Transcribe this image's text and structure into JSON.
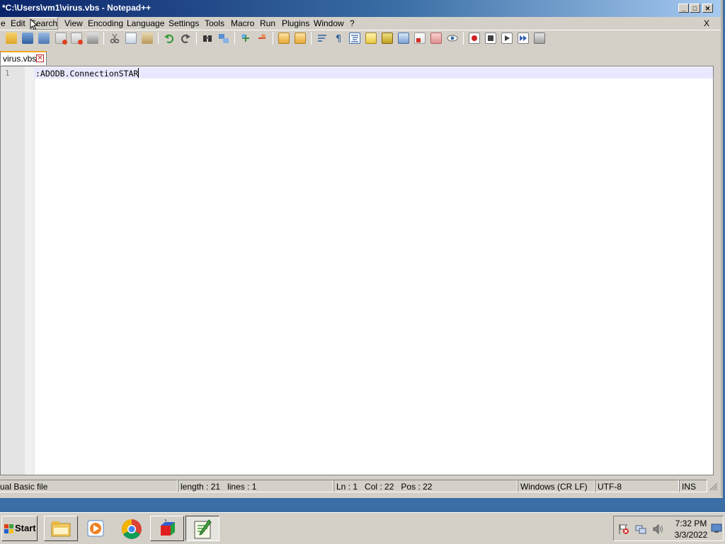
{
  "window": {
    "title": "*C:\\Users\\vm1\\virus.vbs - Notepad++",
    "minimize": "_",
    "maximize": "□",
    "close": "✕"
  },
  "menu": {
    "items": [
      "e",
      "Edit",
      "Search",
      "View",
      "Encoding",
      "Language",
      "Settings",
      "Tools",
      "Macro",
      "Run",
      "Plugins",
      "Window",
      "?"
    ],
    "close": "X"
  },
  "toolbar": {
    "icons": [
      "open-file-icon",
      "save-icon",
      "save-all-icon",
      "close-icon",
      "close-all-icon",
      "print-icon",
      "cut-icon",
      "copy-icon",
      "paste-icon",
      "undo-icon",
      "redo-icon",
      "find-icon",
      "replace-icon",
      "zoom-in-icon",
      "zoom-out-icon",
      "sync-vertical-icon",
      "sync-horizontal-icon",
      "word-wrap-icon",
      "show-all-chars-icon",
      "indent-guide-icon",
      "user-language-icon",
      "doc-map-icon",
      "function-list-icon",
      "folder-workspace-icon",
      "monitoring-icon",
      "record-macro-icon",
      "stop-macro-icon",
      "play-macro-icon",
      "run-macro-multiple-icon",
      "save-macro-icon"
    ]
  },
  "tab": {
    "label": "virus.vbs",
    "close": "✕"
  },
  "editor": {
    "line_number": "1",
    "code": ":ADODB.ConnectionSTAR"
  },
  "status": {
    "language": "ual Basic file",
    "length": "length : 21",
    "lines": "lines : 1",
    "ln": "Ln : 1",
    "col": "Col : 22",
    "pos": "Pos : 22",
    "eol": "Windows (CR LF)",
    "encoding": "UTF-8",
    "mode": "INS"
  },
  "taskbar": {
    "start_label": "Start",
    "apps": [
      "file-explorer-icon",
      "media-player-icon",
      "chrome-icon",
      "3d-builder-icon",
      "notepad-plus-plus-icon"
    ],
    "clock_time": "7:32 PM",
    "clock_date": "3/3/2022"
  },
  "colors": {
    "title_gradient_start": "#0a246a",
    "desktop": "#3a6ea5",
    "current_line": "#e8e8ff",
    "tab_accent": "#f5a623"
  }
}
